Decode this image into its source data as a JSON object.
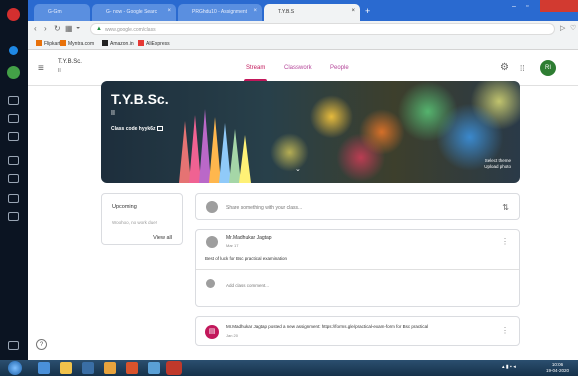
{
  "browser": {
    "tabs": [
      {
        "label": "G-Gm",
        "active": false
      },
      {
        "label": "G- now - Google Searc",
        "active": false
      },
      {
        "label": "PRGhdu10 - Assignment",
        "active": false
      },
      {
        "label": "T.Y.B.S",
        "active": true
      }
    ],
    "url": "www.google.com/class",
    "bookmarks": [
      "Flipkart",
      "Myntra.com",
      "Amazon.in",
      "AliExpress"
    ]
  },
  "classroom": {
    "class_name": "T.Y.B.Sc.",
    "class_section": "II",
    "nav_tabs": [
      "Stream",
      "Classwork",
      "People"
    ],
    "active_tab": "Stream",
    "profile_initials": "RI"
  },
  "banner": {
    "title": "T.Y.B.Sc.",
    "subtitle": "II",
    "class_code_label": "Class code",
    "class_code": "hyyk6z",
    "upload_line1": "Select theme",
    "upload_line2": "Upload photo"
  },
  "upcoming": {
    "title": "Upcoming",
    "subtitle": "Woohoo, no work due!",
    "view_all": "View all"
  },
  "share": {
    "placeholder": "Share something with your class..."
  },
  "post": {
    "author": "Mr.Madhukar Jagtap",
    "date": "Mar 17",
    "body": "Best of luck for Bsc practical examination",
    "comment_placeholder": "Add class comment..."
  },
  "assignment": {
    "text": "Mr.Madhukar Jagtap posted a new assignment: https://forms.gle/practical-exam-form for Bsc practical",
    "date": "Jan 20"
  },
  "taskbar": {
    "time": "10:06",
    "date": "19-04-2020"
  },
  "colors": {
    "accent": "#c2185b",
    "profile": "#2e7d32",
    "tabstrip": "#2a6ad0"
  }
}
